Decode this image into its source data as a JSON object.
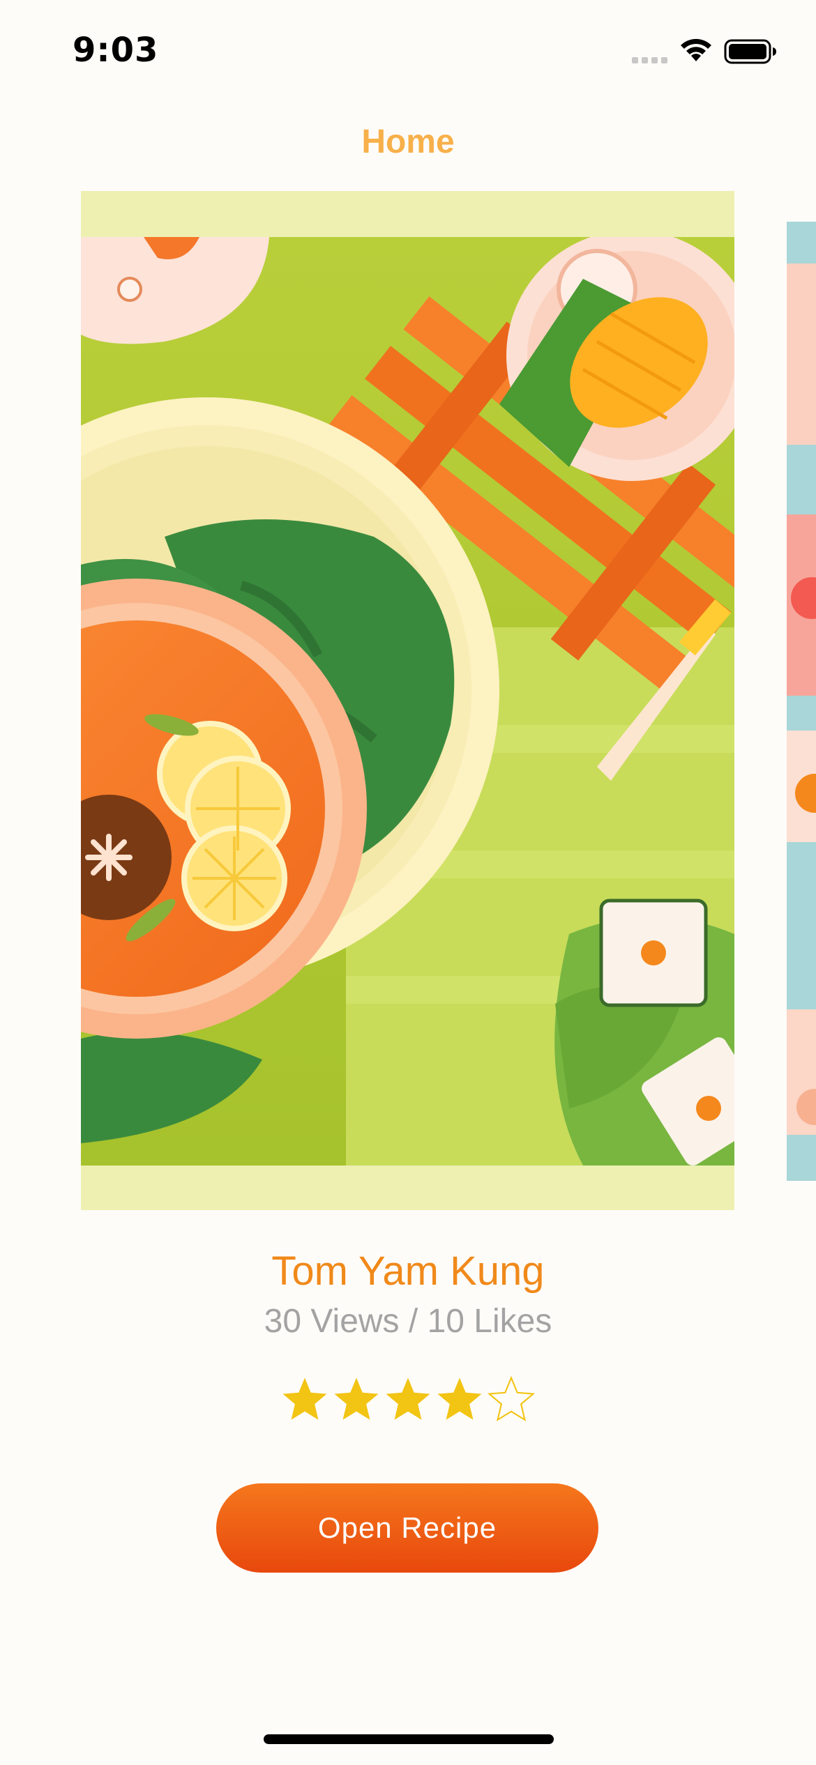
{
  "status_bar": {
    "time": "9:03",
    "icons": [
      "cellular-signal-icon",
      "wifi-icon",
      "battery-icon"
    ]
  },
  "navigation": {
    "title": "Home"
  },
  "carousel": {
    "cards": [
      {
        "name": "Tom Yam Kung",
        "illustration": "tom-yam-kung-illustration",
        "active": true
      },
      {
        "name": "",
        "illustration": "next-recipe-illustration",
        "active": false
      }
    ]
  },
  "recipe": {
    "title": "Tom Yam Kung",
    "stats": "30 Views /  10 Likes",
    "rating": 4,
    "rating_max": 5
  },
  "actions": {
    "open_recipe_label": "Open Recipe"
  },
  "colors": {
    "nav_title": "#f7b04a",
    "recipe_title": "#f0891a",
    "stats_text": "#a3a3a3",
    "star_filled": "#f2c413",
    "button_top": "#f5771c",
    "button_bottom": "#e8480d",
    "card_frame": "#eef0b2",
    "background": "#fefcf9"
  }
}
